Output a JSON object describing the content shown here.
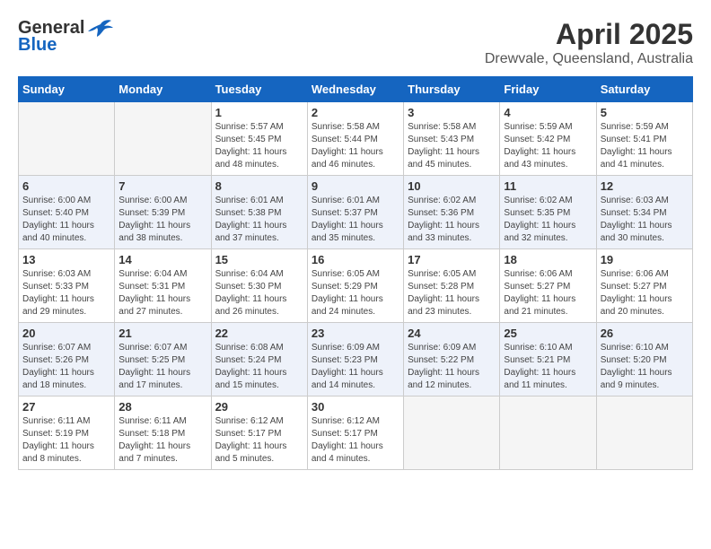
{
  "header": {
    "logo_line1": "General",
    "logo_line2": "Blue",
    "month_year": "April 2025",
    "location": "Drewvale, Queensland, Australia"
  },
  "weekdays": [
    "Sunday",
    "Monday",
    "Tuesday",
    "Wednesday",
    "Thursday",
    "Friday",
    "Saturday"
  ],
  "weeks": [
    [
      {
        "day": "",
        "info": ""
      },
      {
        "day": "",
        "info": ""
      },
      {
        "day": "1",
        "info": "Sunrise: 5:57 AM\nSunset: 5:45 PM\nDaylight: 11 hours\nand 48 minutes."
      },
      {
        "day": "2",
        "info": "Sunrise: 5:58 AM\nSunset: 5:44 PM\nDaylight: 11 hours\nand 46 minutes."
      },
      {
        "day": "3",
        "info": "Sunrise: 5:58 AM\nSunset: 5:43 PM\nDaylight: 11 hours\nand 45 minutes."
      },
      {
        "day": "4",
        "info": "Sunrise: 5:59 AM\nSunset: 5:42 PM\nDaylight: 11 hours\nand 43 minutes."
      },
      {
        "day": "5",
        "info": "Sunrise: 5:59 AM\nSunset: 5:41 PM\nDaylight: 11 hours\nand 41 minutes."
      }
    ],
    [
      {
        "day": "6",
        "info": "Sunrise: 6:00 AM\nSunset: 5:40 PM\nDaylight: 11 hours\nand 40 minutes."
      },
      {
        "day": "7",
        "info": "Sunrise: 6:00 AM\nSunset: 5:39 PM\nDaylight: 11 hours\nand 38 minutes."
      },
      {
        "day": "8",
        "info": "Sunrise: 6:01 AM\nSunset: 5:38 PM\nDaylight: 11 hours\nand 37 minutes."
      },
      {
        "day": "9",
        "info": "Sunrise: 6:01 AM\nSunset: 5:37 PM\nDaylight: 11 hours\nand 35 minutes."
      },
      {
        "day": "10",
        "info": "Sunrise: 6:02 AM\nSunset: 5:36 PM\nDaylight: 11 hours\nand 33 minutes."
      },
      {
        "day": "11",
        "info": "Sunrise: 6:02 AM\nSunset: 5:35 PM\nDaylight: 11 hours\nand 32 minutes."
      },
      {
        "day": "12",
        "info": "Sunrise: 6:03 AM\nSunset: 5:34 PM\nDaylight: 11 hours\nand 30 minutes."
      }
    ],
    [
      {
        "day": "13",
        "info": "Sunrise: 6:03 AM\nSunset: 5:33 PM\nDaylight: 11 hours\nand 29 minutes."
      },
      {
        "day": "14",
        "info": "Sunrise: 6:04 AM\nSunset: 5:31 PM\nDaylight: 11 hours\nand 27 minutes."
      },
      {
        "day": "15",
        "info": "Sunrise: 6:04 AM\nSunset: 5:30 PM\nDaylight: 11 hours\nand 26 minutes."
      },
      {
        "day": "16",
        "info": "Sunrise: 6:05 AM\nSunset: 5:29 PM\nDaylight: 11 hours\nand 24 minutes."
      },
      {
        "day": "17",
        "info": "Sunrise: 6:05 AM\nSunset: 5:28 PM\nDaylight: 11 hours\nand 23 minutes."
      },
      {
        "day": "18",
        "info": "Sunrise: 6:06 AM\nSunset: 5:27 PM\nDaylight: 11 hours\nand 21 minutes."
      },
      {
        "day": "19",
        "info": "Sunrise: 6:06 AM\nSunset: 5:27 PM\nDaylight: 11 hours\nand 20 minutes."
      }
    ],
    [
      {
        "day": "20",
        "info": "Sunrise: 6:07 AM\nSunset: 5:26 PM\nDaylight: 11 hours\nand 18 minutes."
      },
      {
        "day": "21",
        "info": "Sunrise: 6:07 AM\nSunset: 5:25 PM\nDaylight: 11 hours\nand 17 minutes."
      },
      {
        "day": "22",
        "info": "Sunrise: 6:08 AM\nSunset: 5:24 PM\nDaylight: 11 hours\nand 15 minutes."
      },
      {
        "day": "23",
        "info": "Sunrise: 6:09 AM\nSunset: 5:23 PM\nDaylight: 11 hours\nand 14 minutes."
      },
      {
        "day": "24",
        "info": "Sunrise: 6:09 AM\nSunset: 5:22 PM\nDaylight: 11 hours\nand 12 minutes."
      },
      {
        "day": "25",
        "info": "Sunrise: 6:10 AM\nSunset: 5:21 PM\nDaylight: 11 hours\nand 11 minutes."
      },
      {
        "day": "26",
        "info": "Sunrise: 6:10 AM\nSunset: 5:20 PM\nDaylight: 11 hours\nand 9 minutes."
      }
    ],
    [
      {
        "day": "27",
        "info": "Sunrise: 6:11 AM\nSunset: 5:19 PM\nDaylight: 11 hours\nand 8 minutes."
      },
      {
        "day": "28",
        "info": "Sunrise: 6:11 AM\nSunset: 5:18 PM\nDaylight: 11 hours\nand 7 minutes."
      },
      {
        "day": "29",
        "info": "Sunrise: 6:12 AM\nSunset: 5:17 PM\nDaylight: 11 hours\nand 5 minutes."
      },
      {
        "day": "30",
        "info": "Sunrise: 6:12 AM\nSunset: 5:17 PM\nDaylight: 11 hours\nand 4 minutes."
      },
      {
        "day": "",
        "info": ""
      },
      {
        "day": "",
        "info": ""
      },
      {
        "day": "",
        "info": ""
      }
    ]
  ]
}
